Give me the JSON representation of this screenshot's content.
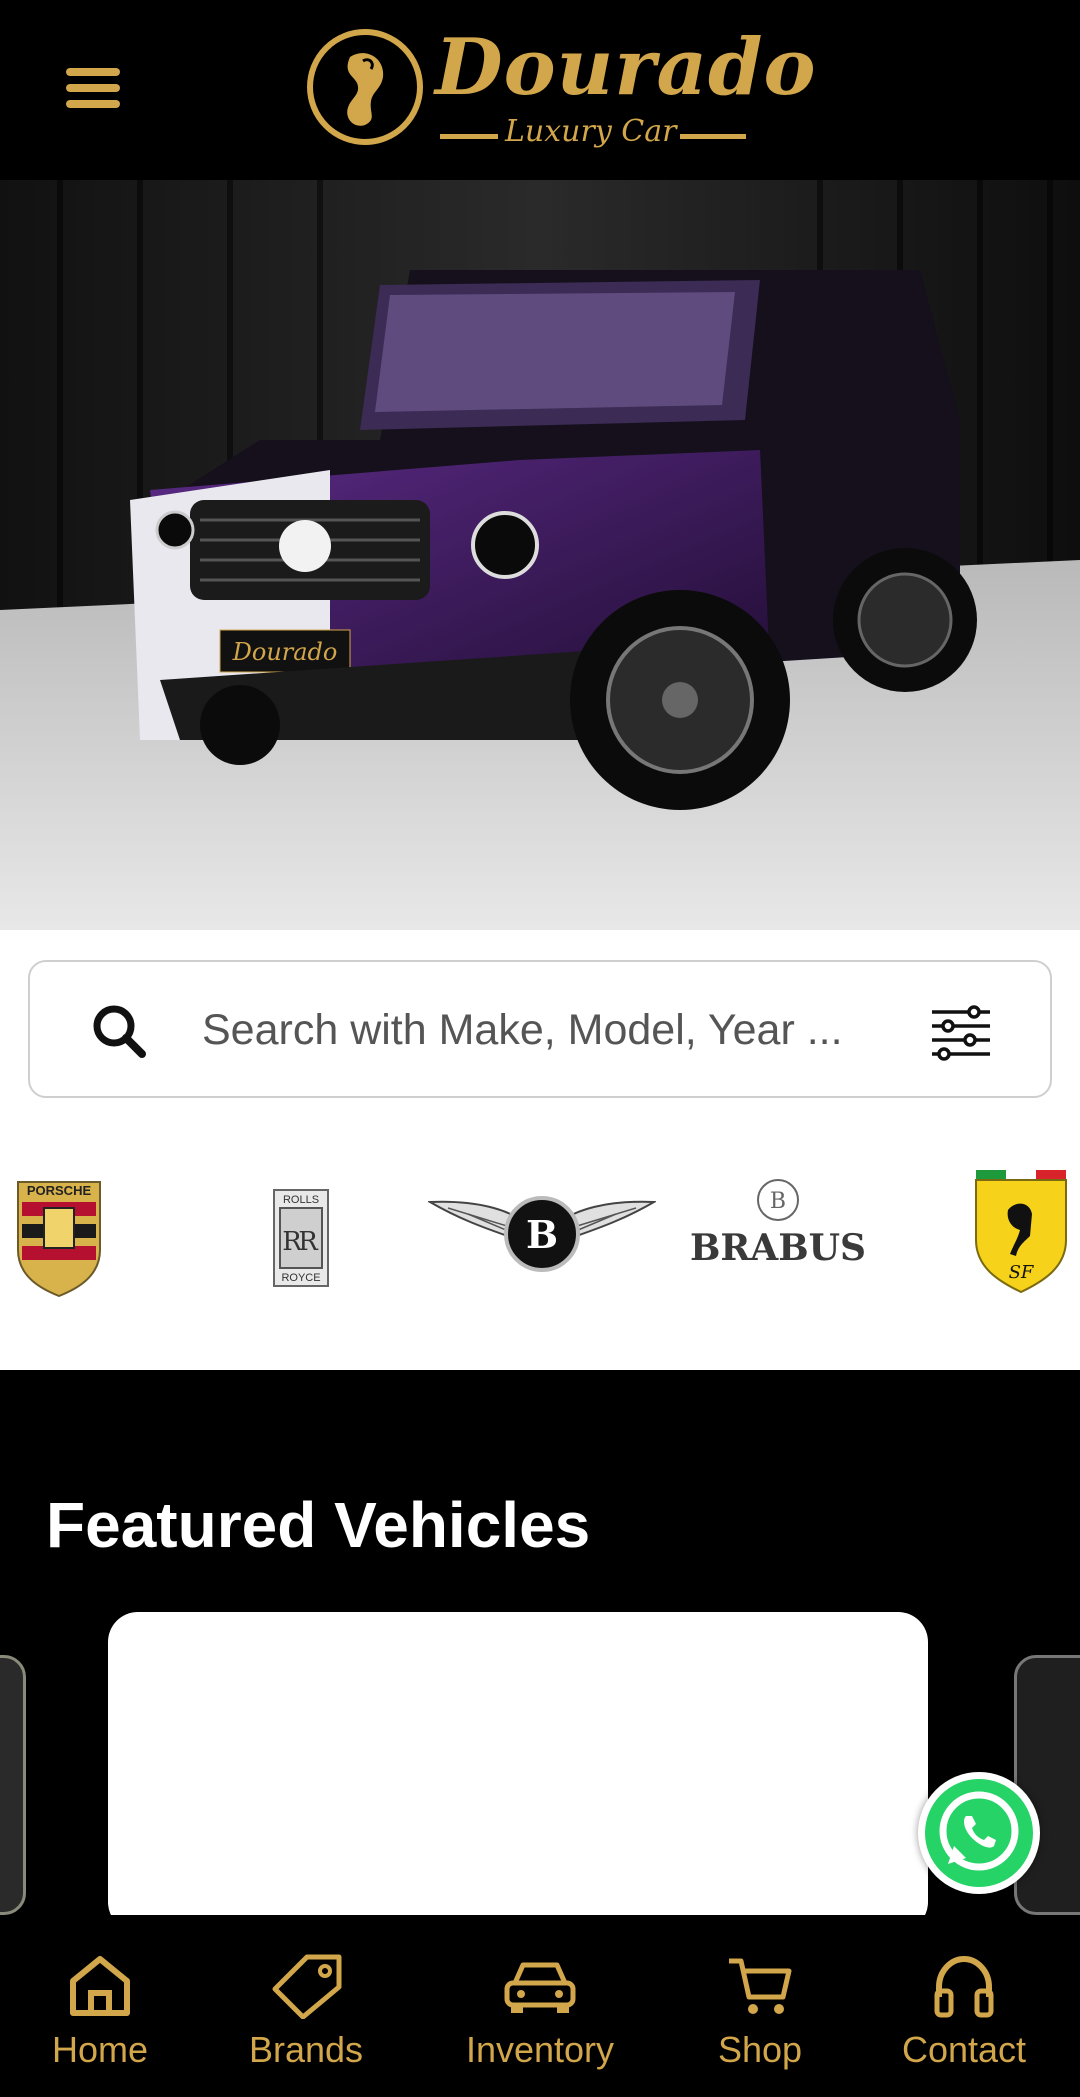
{
  "header": {
    "menu_icon": "hamburger-menu-icon",
    "logo": {
      "name": "Dourado",
      "tagline": "Luxury Car"
    }
  },
  "hero": {
    "image_alt": "Purple and white luxury SUV in showroom",
    "plate_text": "Dourado"
  },
  "search": {
    "placeholder": "Search with Make, Model, Year ...",
    "search_icon": "search-icon",
    "filter_icon": "sliders-filter-icon"
  },
  "brands": [
    {
      "name": "Porsche",
      "logo_text": "PORSCHE"
    },
    {
      "name": "Rolls-Royce",
      "logo_text_top": "ROLLS",
      "logo_text_bottom": "ROYCE"
    },
    {
      "name": "Bentley",
      "logo_text": "B"
    },
    {
      "name": "Brabus",
      "logo_text": "BRABUS"
    },
    {
      "name": "Ferrari",
      "logo_text": "SF"
    }
  ],
  "featured": {
    "title": "Featured Vehicles"
  },
  "whatsapp": {
    "icon": "whatsapp-icon"
  },
  "bottom_nav": [
    {
      "label": "Home",
      "icon": "home-icon"
    },
    {
      "label": "Brands",
      "icon": "tag-icon"
    },
    {
      "label": "Inventory",
      "icon": "car-icon"
    },
    {
      "label": "Shop",
      "icon": "cart-icon"
    },
    {
      "label": "Contact",
      "icon": "headphones-icon"
    }
  ],
  "colors": {
    "gold": "#d2a64a",
    "background": "#000000",
    "accent_purple": "#4a1f6e"
  }
}
